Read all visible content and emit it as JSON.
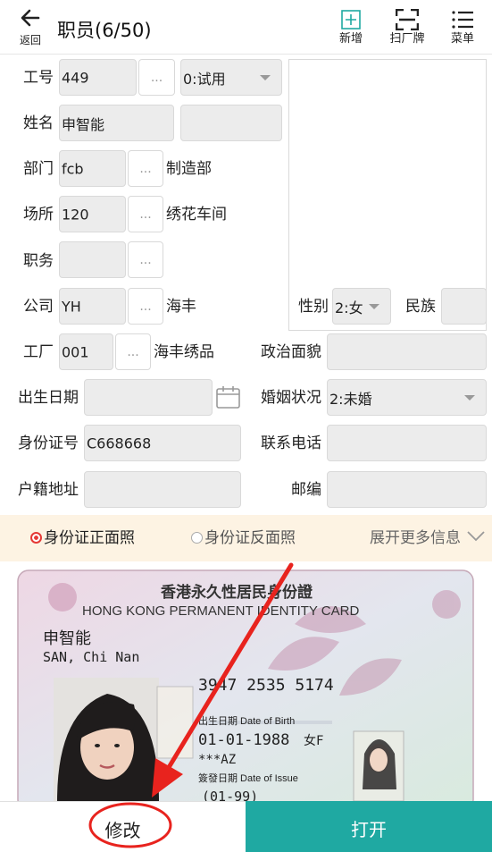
{
  "header": {
    "back_label": "返回",
    "title": "职员(6/50)",
    "add_label": "新增",
    "scan_label": "扫厂牌",
    "menu_label": "菜单"
  },
  "form": {
    "job_no": {
      "label": "工号",
      "value": "449",
      "status": "0:试用"
    },
    "name": {
      "label": "姓名",
      "value": "申智能",
      "value2": ""
    },
    "dept": {
      "label": "部门",
      "code": "fcb",
      "name": "制造部"
    },
    "place": {
      "label": "场所",
      "code": "120",
      "name": "绣花车间"
    },
    "position": {
      "label": "职务",
      "code": ""
    },
    "company": {
      "label": "公司",
      "code": "YH",
      "name": "海丰"
    },
    "gender": {
      "label": "性别",
      "value": "2:女"
    },
    "ethnicity": {
      "label": "民族",
      "value": ""
    },
    "factory": {
      "label": "工厂",
      "code": "001",
      "name": "海丰绣品"
    },
    "political": {
      "label": "政治面貌",
      "value": ""
    },
    "birth": {
      "label": "出生日期",
      "value": ""
    },
    "marital": {
      "label": "婚姻状况",
      "value": "2:未婚"
    },
    "id_no": {
      "label": "身份证号",
      "value": "C668668"
    },
    "phone": {
      "label": "联系电话",
      "value": ""
    },
    "domicile": {
      "label": "户籍地址",
      "value": ""
    },
    "postcode": {
      "label": "邮编",
      "value": ""
    },
    "dots": "..."
  },
  "tabs": {
    "front": "身份证正面照",
    "back": "身份证反面照",
    "more": "展开更多信息"
  },
  "id_card": {
    "title_cn": "香港永久性居民身份證",
    "title_en": "HONG KONG PERMANENT IDENTITY CARD",
    "name_cn": "申智能",
    "name_en": "SAN, Chi Nan",
    "number": "3947 2535 5174",
    "dob_label": "出生日期 Date of Birth",
    "dob": "01-01-1988",
    "sex": "女F",
    "symbols": "***AZ",
    "issue_label": "簽發日期 Date of Issue",
    "issue": "(01-99)"
  },
  "bottom": {
    "edit_label": "修改",
    "open_label": "打开"
  },
  "colors": {
    "accent": "#1fa9a2",
    "radio_active": "#e53935",
    "annotation": "#e8231e",
    "tab_bg": "#fdf3e3"
  }
}
